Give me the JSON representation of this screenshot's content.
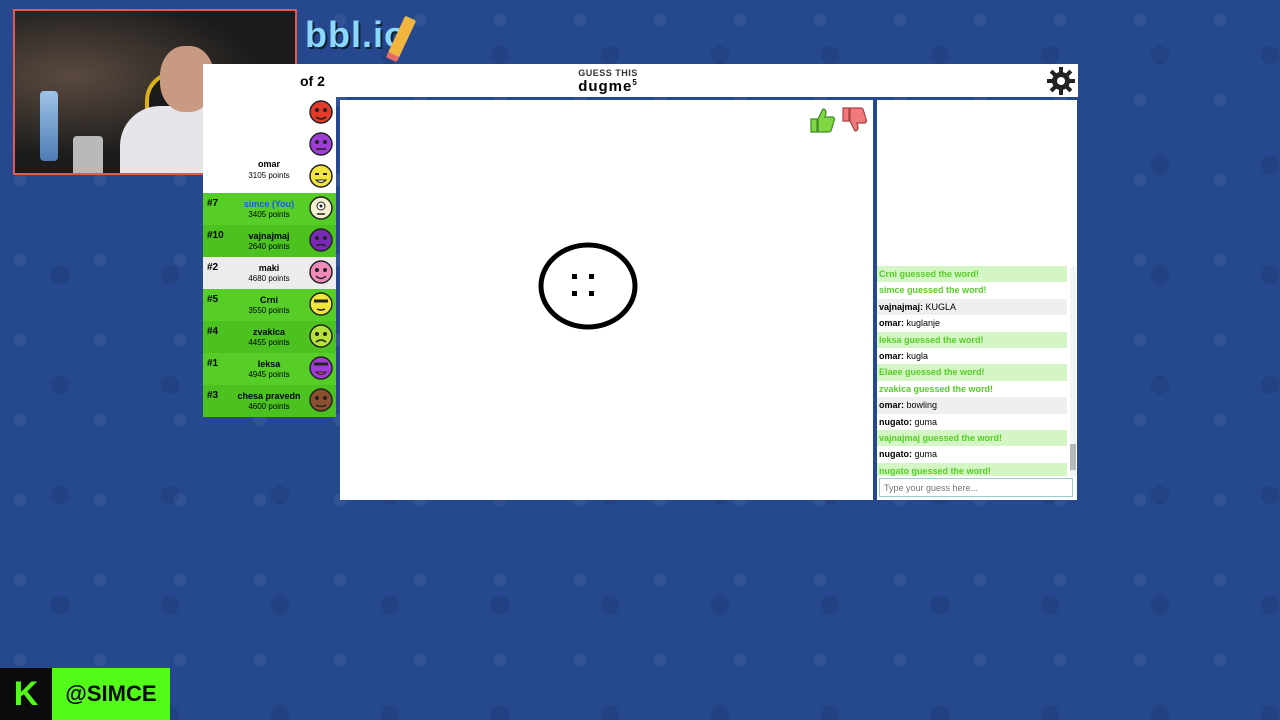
{
  "logo": {
    "text": "bbl.io"
  },
  "header": {
    "round_text": "of 2",
    "guess_label": "GUESS THIS",
    "word": "dugme",
    "word_length": "5"
  },
  "players": [
    {
      "rank": "",
      "name": "",
      "points": "",
      "avatar_color": "#e53a2a"
    },
    {
      "rank": "",
      "name": "",
      "points": "",
      "avatar_color": "#a03cd8"
    },
    {
      "rank": "",
      "name": "omar",
      "points": "3105 points",
      "avatar_color": "#f1e43a"
    },
    {
      "rank": "#7",
      "name": "simce (You)",
      "points": "3405 points",
      "avatar_color": "#f4f0d0"
    },
    {
      "rank": "#10",
      "name": "vajnajmaj",
      "points": "2640 points",
      "avatar_color": "#7a2ab8"
    },
    {
      "rank": "#2",
      "name": "maki",
      "points": "4680 points",
      "avatar_color": "#f08ab8"
    },
    {
      "rank": "#5",
      "name": "Crni",
      "points": "3550 points",
      "avatar_color": "#f1e43a"
    },
    {
      "rank": "#4",
      "name": "zvakica",
      "points": "4455 points",
      "avatar_color": "#b4e23a"
    },
    {
      "rank": "#1",
      "name": "leksa",
      "points": "4945 points",
      "avatar_color": "#a03cd8"
    },
    {
      "rank": "#3",
      "name": "chesa pravedn",
      "points": "4600 points",
      "avatar_color": "#8a5030"
    }
  ],
  "chat": {
    "messages": [
      {
        "type": "system",
        "text": "Crni guessed the word!"
      },
      {
        "type": "system",
        "text": "simce guessed the word!"
      },
      {
        "type": "user",
        "user": "vajnajmaj:",
        "text": " KUGLA"
      },
      {
        "type": "user",
        "user": "omar:",
        "text": " kuglanje"
      },
      {
        "type": "system",
        "text": "leksa guessed the word!"
      },
      {
        "type": "user",
        "user": "omar:",
        "text": " kugla"
      },
      {
        "type": "system",
        "text": "Elaee guessed the word!"
      },
      {
        "type": "system",
        "text": "zvakica guessed the word!"
      },
      {
        "type": "user",
        "user": "omar:",
        "text": " bowling"
      },
      {
        "type": "user",
        "user": "nugato:",
        "text": " guma"
      },
      {
        "type": "system",
        "text": "vajnajmaj guessed the word!"
      },
      {
        "type": "user",
        "user": "nugato:",
        "text": " guma"
      },
      {
        "type": "system",
        "text": "nugato guessed the word!"
      }
    ],
    "input_placeholder": "Type your guess here..."
  },
  "stream": {
    "kick_icon": "K",
    "handle": "@SIMCE"
  },
  "icons": {
    "settings": "gear-icon",
    "like": "thumbs-up-icon",
    "dislike": "thumbs-down-icon"
  },
  "colors": {
    "background": "#25488e",
    "guessed_green": "#56ce27",
    "kick_green": "#53fc18"
  }
}
